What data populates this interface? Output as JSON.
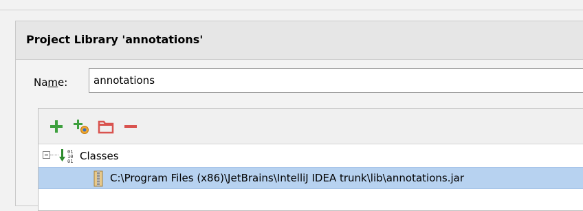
{
  "dialog": {
    "title": "Project Library 'annotations'"
  },
  "name_field": {
    "label_prefix": "Na",
    "label_mnemonic": "m",
    "label_suffix": "e:",
    "value": "annotations"
  },
  "toolbar": {
    "buttons": [
      {
        "icon": "add-icon",
        "color": "#3ea03e"
      },
      {
        "icon": "add-javadoc-icon",
        "color": "#3ea03e"
      },
      {
        "icon": "folder-icon",
        "color": "#d9534f"
      },
      {
        "icon": "remove-icon",
        "color": "#d9534f"
      }
    ]
  },
  "tree": {
    "root": {
      "label": "Classes",
      "expanded": true,
      "icon": "classes-root-icon",
      "icon_digits": [
        "01",
        "10",
        "01"
      ]
    },
    "items": [
      {
        "label": "C:\\Program Files (x86)\\JetBrains\\IntelliJ IDEA trunk\\lib\\annotations.jar",
        "icon": "jar-archive-icon",
        "selected": true
      }
    ]
  },
  "colors": {
    "selection": "#b7d2f0",
    "header_bg": "#e6e6e6"
  }
}
